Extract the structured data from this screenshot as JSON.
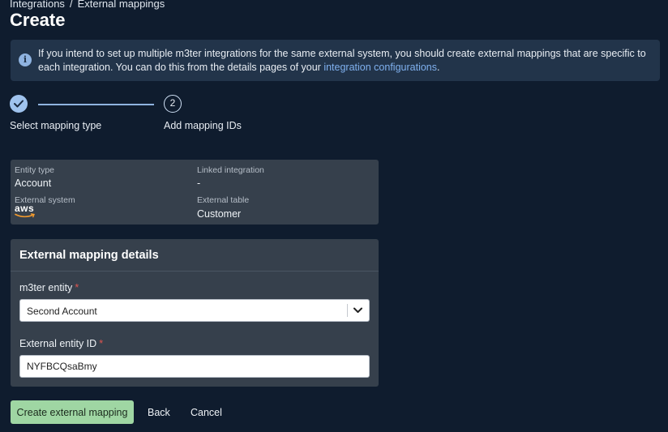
{
  "breadcrumb": {
    "items": [
      "Integrations",
      "External mappings"
    ],
    "separator": "/"
  },
  "page": {
    "title": "Create"
  },
  "info": {
    "text_before": "If you intend to set up multiple m3ter integrations for the same external system, you should create external mappings that are specific to each integration. You can do this from the details pages of your ",
    "link_text": "integration configurations",
    "text_after": ".",
    "icon": "info-icon"
  },
  "stepper": {
    "steps": [
      {
        "label": "Select mapping type",
        "status": "complete",
        "icon": "checkmark-icon"
      },
      {
        "label": "Add mapping IDs",
        "status": "current",
        "number": "2"
      }
    ]
  },
  "summary": {
    "entity_type_label": "Entity type",
    "entity_type_value": "Account",
    "linked_integration_label": "Linked integration",
    "linked_integration_value": "-",
    "external_system_label": "External system",
    "external_system_logo_text": "aws",
    "external_table_label": "External table",
    "external_table_value": "Customer"
  },
  "details": {
    "title": "External mapping details",
    "entity_label": "m3ter entity",
    "entity_value": "Second Account",
    "external_id_label": "External entity ID",
    "external_id_value": "NYFBCQsaBmy",
    "required_mark": "*"
  },
  "actions": {
    "create_label": "Create external mapping",
    "back_label": "Back",
    "cancel_label": "Cancel"
  },
  "colors": {
    "background": "#0f1c2e",
    "card": "#36404c",
    "info_box": "#22344a",
    "link": "#7fb0ee",
    "primary_button": "#9fd6a3",
    "required": "#e0554f"
  }
}
